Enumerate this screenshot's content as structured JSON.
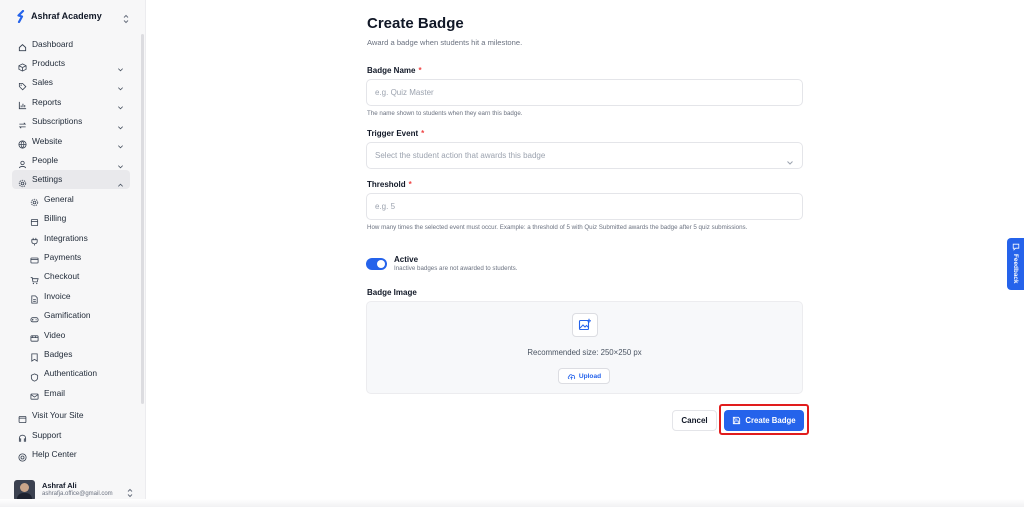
{
  "sidebar": {
    "brand": "Ashraf Academy",
    "items": [
      {
        "label": "Dashboard",
        "icon": "home-icon"
      },
      {
        "label": "Products",
        "icon": "box-icon"
      },
      {
        "label": "Sales",
        "icon": "tag-icon"
      },
      {
        "label": "Reports",
        "icon": "bar-chart-icon"
      },
      {
        "label": "Subscriptions",
        "icon": "repeat-icon"
      },
      {
        "label": "Website",
        "icon": "globe-icon"
      },
      {
        "label": "People",
        "icon": "user-icon"
      },
      {
        "label": "Settings",
        "icon": "gear-icon"
      }
    ],
    "settings_items": [
      {
        "label": "General",
        "icon": "gear-icon"
      },
      {
        "label": "Billing",
        "icon": "document-icon"
      },
      {
        "label": "Integrations",
        "icon": "plug-icon"
      },
      {
        "label": "Payments",
        "icon": "credit-card-icon"
      },
      {
        "label": "Checkout",
        "icon": "cart-icon"
      },
      {
        "label": "Invoice",
        "icon": "file-icon"
      },
      {
        "label": "Gamification",
        "icon": "gamepad-icon"
      },
      {
        "label": "Video",
        "icon": "video-icon"
      },
      {
        "label": "Badges",
        "icon": "badge-icon"
      },
      {
        "label": "Authentication",
        "icon": "shield-icon"
      },
      {
        "label": "Email",
        "icon": "mail-icon"
      }
    ],
    "footer_items": [
      {
        "label": "Visit Your Site",
        "icon": "external-link-icon"
      },
      {
        "label": "Support",
        "icon": "headset-icon"
      },
      {
        "label": "Help Center",
        "icon": "lifebuoy-icon"
      }
    ],
    "user": {
      "name": "Ashraf Ali",
      "email": "ashrafja.office@gmail.com"
    }
  },
  "form": {
    "title": "Create Badge",
    "subtitle": "Award a badge when students hit a milestone.",
    "badge_name": {
      "label": "Badge Name",
      "required_mark": "*",
      "placeholder": "e.g. Quiz Master",
      "value": "",
      "help": "The name shown to students when they earn this badge."
    },
    "trigger_event": {
      "label": "Trigger Event",
      "required_mark": "*",
      "placeholder": "Select the student action that awards this badge"
    },
    "threshold": {
      "label": "Threshold",
      "required_mark": "*",
      "placeholder": "e.g. 5",
      "value": "",
      "help": "How many times the selected event must occur. Example: a threshold of 5 with Quiz Submitted awards the badge after 5 quiz submissions."
    },
    "active": {
      "label": "Active",
      "description": "Inactive badges are not awarded to students.",
      "checked": true
    },
    "badge_image": {
      "label": "Badge Image",
      "recommended": "Recommended size: 250×250 px",
      "upload_label": "Upload"
    },
    "cancel_label": "Cancel",
    "submit_label": "Create Badge"
  },
  "feedback_label": "Feedback",
  "colors": {
    "accent": "#2563eb",
    "required": "#ef4444",
    "highlight": "#e11d1d",
    "sidebar_bg": "#f7f7f8"
  }
}
